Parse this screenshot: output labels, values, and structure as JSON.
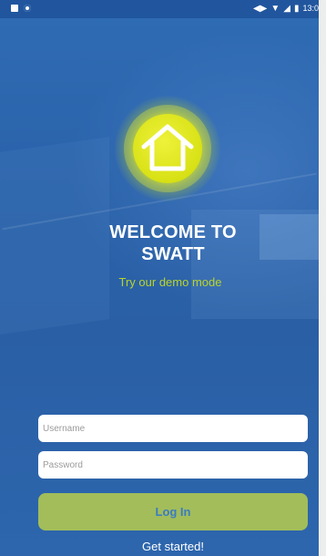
{
  "status_bar": {
    "left_icons": [
      "notification-square-icon",
      "sync-circle-icon"
    ],
    "right_icons": [
      "vibrate-icon",
      "wifi-icon",
      "signal-icon",
      "battery-icon"
    ],
    "time": "13:0"
  },
  "logo": {
    "icon": "home-icon",
    "color": "#d8e115"
  },
  "welcome": {
    "line1": "WELCOME TO",
    "line2": "SWATT"
  },
  "demo_link": "Try our demo mode",
  "form": {
    "username_placeholder": "Username",
    "username_value": "",
    "password_placeholder": "Password",
    "password_value": "",
    "login_label": "Log In"
  },
  "get_started_label": "Get started!",
  "colors": {
    "background": "#2a5fa5",
    "accent_green": "#a2bd5a",
    "demo_text": "#b9d42a",
    "button_text": "#3d7bc2"
  }
}
